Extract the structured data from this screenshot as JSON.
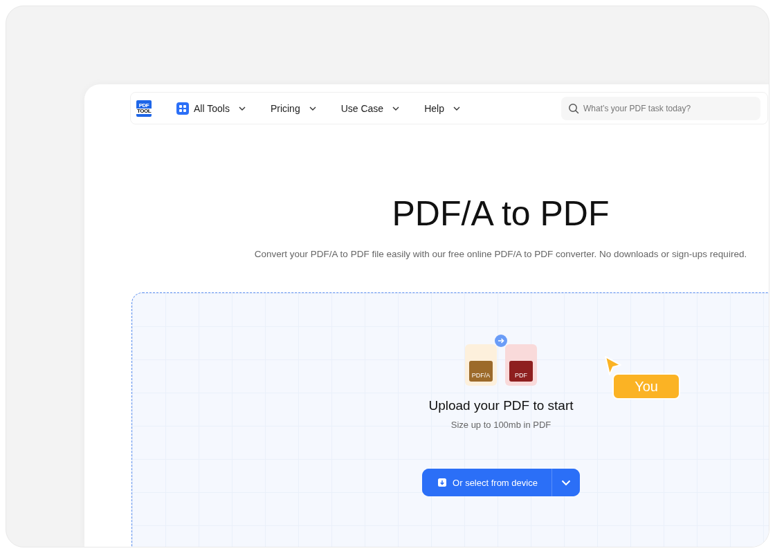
{
  "logo": {
    "lines": [
      "PDF",
      "TOOL"
    ]
  },
  "nav": {
    "items": [
      {
        "label": "All Tools",
        "kind": "apps"
      },
      {
        "label": "Pricing",
        "kind": "text"
      },
      {
        "label": "Use Case",
        "kind": "text"
      },
      {
        "label": "Help",
        "kind": "text"
      }
    ]
  },
  "search": {
    "placeholder": "What’s your PDF task today?"
  },
  "hero": {
    "title": "PDF/A to PDF",
    "subtitle": "Convert your PDF/A to PDF file easily with our free online PDF/A to PDF converter. No downloads or sign-ups required."
  },
  "upload": {
    "files": [
      {
        "label": "PDF/A",
        "color": "#9c6a2a"
      },
      {
        "label": "PDF",
        "color": "#8e1f1f"
      }
    ],
    "heading": "Upload your PDF to start",
    "note": "Size up to 100mb in PDF",
    "button": "Or select from device"
  },
  "cursor": {
    "label": "You"
  }
}
